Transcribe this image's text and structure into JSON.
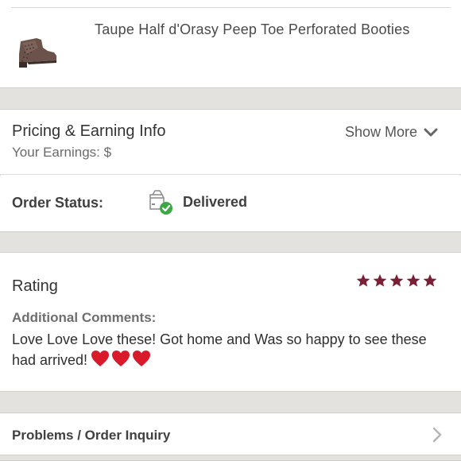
{
  "product": {
    "title": "Taupe Half d'Orasy Peep Toe Perforated Booties"
  },
  "pricing": {
    "title": "Pricing & Earning Info",
    "earnings_label": "Your Earnings: $",
    "show_more_label": "Show More"
  },
  "order_status": {
    "label": "Order Status:",
    "value": "Delivered"
  },
  "rating": {
    "title": "Rating",
    "stars": 5,
    "star_color": "#7a1f35",
    "comments_label": "Additional Comments:",
    "comments_text": "Love Love Love these! Got home and Was so happy to see these had arrived!",
    "heart_color": "#d91a2a"
  },
  "problems": {
    "label": "Problems / Order Inquiry"
  }
}
